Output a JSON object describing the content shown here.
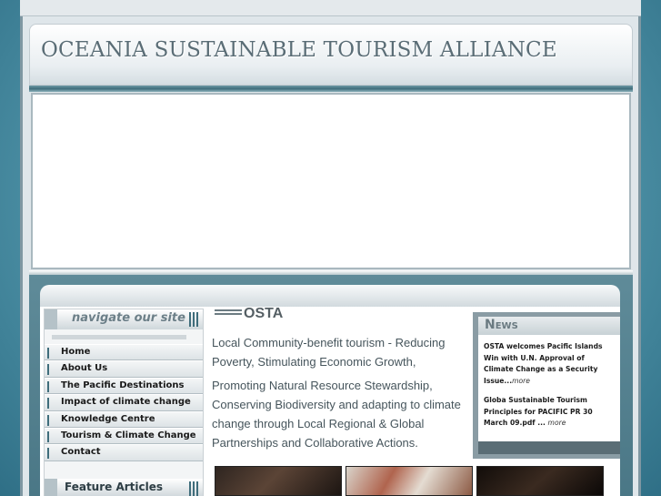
{
  "site": {
    "title": "OCEANIA SUSTAINABLE TOURISM ALLIANCE"
  },
  "sidebar": {
    "heading": "navigate our site",
    "items": [
      {
        "label": "Home"
      },
      {
        "label": "About Us"
      },
      {
        "label": "The Pacific Destinations"
      },
      {
        "label": "Impact of climate change"
      },
      {
        "label": "Knowledge Centre"
      },
      {
        "label": "Tourism & Climate Change"
      },
      {
        "label": "Contact"
      }
    ],
    "feature_heading": "Feature Articles"
  },
  "main": {
    "title": "OSTA",
    "paragraphs": [
      "Local Community-benefit tourism - Reducing Poverty, Stimulating Economic Growth,",
      "Promoting Natural Resource Stewardship, Conserving Biodiversity and adapting to climate change through Local Regional & Global Partnerships and Collaborative Actions."
    ]
  },
  "news": {
    "heading": "News",
    "items": [
      {
        "text": "OSTA welcomes Pacific Islands Win with U.N. Approval of Climate Change as a Security Issue...",
        "more": "more"
      },
      {
        "text": "Globa Sustainable Tourism Principles for PACIFIC PR 30 March 09.pdf ... ",
        "more": "more"
      }
    ]
  },
  "colors": {
    "accent": "#3f6d7b",
    "background": "#4f93a8",
    "news_frame": "#8a9ca4"
  }
}
